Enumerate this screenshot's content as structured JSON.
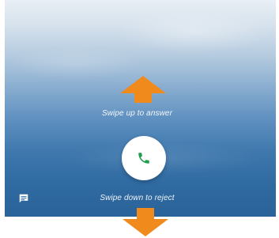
{
  "incoming_call": {
    "swipe_up_label": "Swipe up to answer",
    "swipe_down_label": "Swipe down to reject",
    "answer_icon": "phone-icon",
    "message_icon": "message-icon"
  },
  "colors": {
    "accent_green": "#1e9e4a",
    "arrow_orange": "#f08a1d",
    "background_top": "#e9eff5",
    "background_bottom": "#2a6399"
  }
}
